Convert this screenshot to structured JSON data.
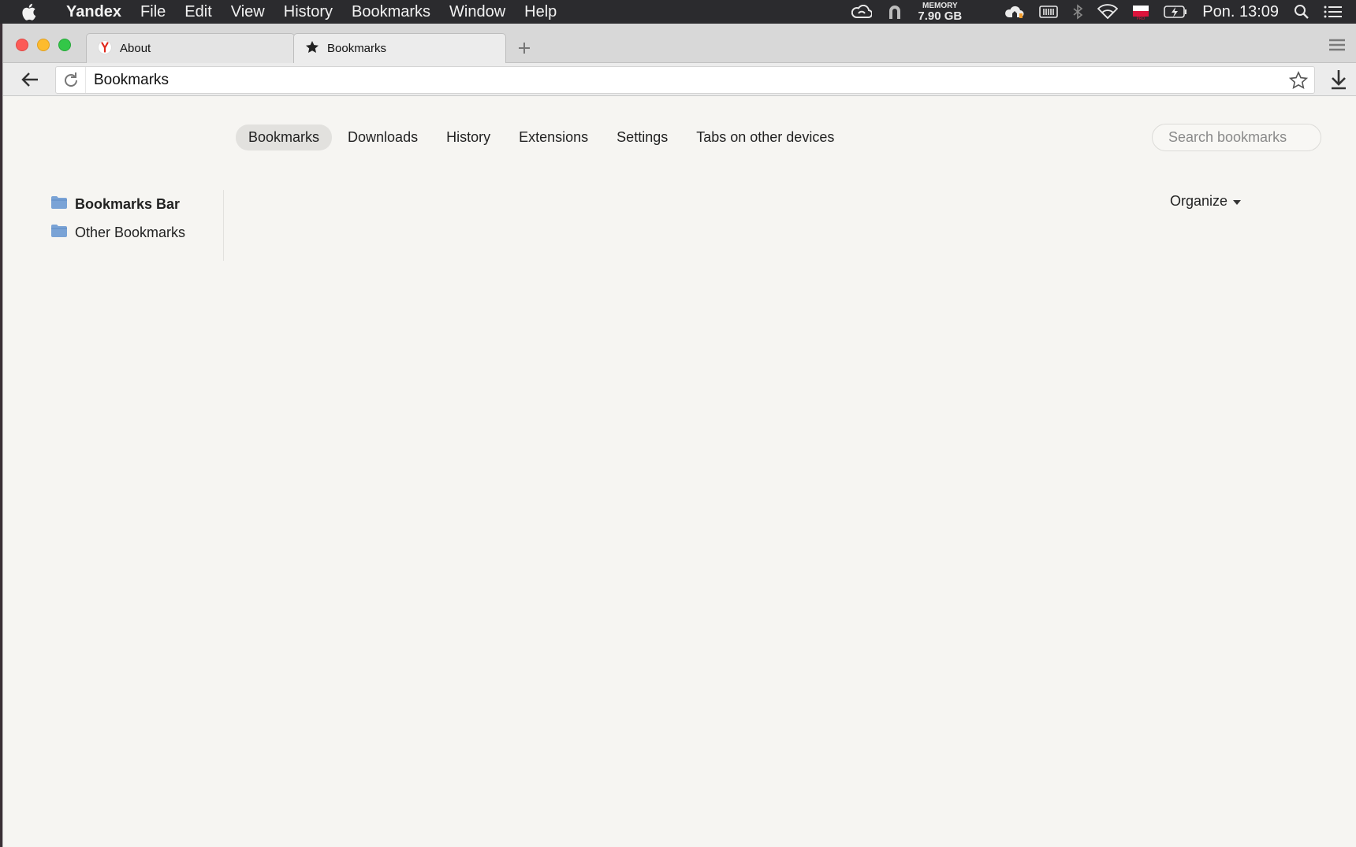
{
  "menubar": {
    "app_name": "Yandex",
    "items": [
      "File",
      "Edit",
      "View",
      "History",
      "Bookmarks",
      "Window",
      "Help"
    ],
    "memory_label": "MEMORY",
    "memory_value": "7.90 GB",
    "clock": "Pon. 13:09",
    "status_icons": [
      "creative-cloud-icon",
      "vpn-icon",
      "memory-monitor",
      "cloud-home-icon",
      "battery-meter-icon",
      "bluetooth-icon",
      "wifi-icon",
      "flag-poland-icon",
      "battery-icon",
      "spotlight-icon",
      "notification-center-icon"
    ]
  },
  "tabs": [
    {
      "label": "About",
      "icon": "yandex-y-icon"
    },
    {
      "label": "Bookmarks",
      "icon": "star-filled-icon"
    }
  ],
  "toolbar": {
    "url": "Bookmarks"
  },
  "page": {
    "nav": [
      "Bookmarks",
      "Downloads",
      "History",
      "Extensions",
      "Settings",
      "Tabs on other devices"
    ],
    "active_nav": "Bookmarks",
    "search_placeholder": "Search bookmarks",
    "folders": [
      "Bookmarks Bar",
      "Other Bookmarks"
    ],
    "organize_label": "Organize"
  },
  "colors": {
    "menubar_bg": "#2b2b2e",
    "page_bg": "#f6f5f2",
    "folder_blue": "#7aa3d6",
    "yandex_red": "#e0291d"
  }
}
